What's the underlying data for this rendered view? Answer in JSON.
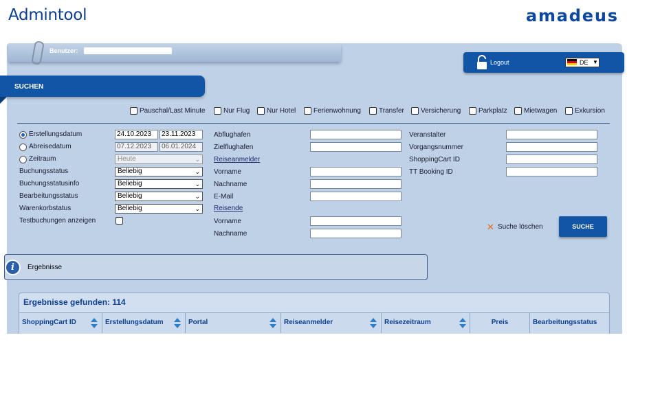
{
  "app": {
    "title": "Admintool",
    "brand": "amadeus",
    "brand_color": "#0d47a1"
  },
  "user": {
    "label": "Benutzer:"
  },
  "session": {
    "logout": "Logout",
    "language": "DE"
  },
  "search_tab": {
    "label": "SUCHEN"
  },
  "products": [
    "Pauschal/Last Minute",
    "Nur Flug",
    "Nur Hotel",
    "Ferienwohnung",
    "Transfer",
    "Versicherung",
    "Parkplatz",
    "Mietwagen",
    "Exkursion"
  ],
  "dates": {
    "erstellungsdatum": {
      "label": "Erstellungsdatum",
      "from": "24.10.2023",
      "to": "23.11.2023",
      "selected": true
    },
    "abreisedatum": {
      "label": "Abreisedatum",
      "from": "07.12.2023",
      "to": "06.01.2024"
    },
    "zeitraum": {
      "label": "Zeitraum",
      "value": "Heute"
    }
  },
  "filters": [
    {
      "label": "Buchungsstatus",
      "value": "Beliebig"
    },
    {
      "label": "Buchungsstatusinfo",
      "value": "Beliebig"
    },
    {
      "label": "Bearbeitungsstatus",
      "value": "Beliebig"
    },
    {
      "label": "Warenkorbstatus",
      "value": "Beliebig"
    }
  ],
  "testbuchungen": {
    "label": "Testbuchungen anzeigen"
  },
  "middle": {
    "abflughafen": "Abflughafen",
    "zielflughafen": "Zielflughafen",
    "reiseanmelder": "Reiseanmelder",
    "vorname": "Vorname",
    "nachname": "Nachname",
    "email": "E-Mail",
    "reisende": "Reisende",
    "vorname2": "Vorname",
    "nachname2": "Nachname"
  },
  "right": {
    "veranstalter": "Veranstalter",
    "vorgangsnummer": "Vorgangsnummer",
    "shoppingcart_id": "ShoppingCart ID",
    "tt_booking_id": "TT Booking ID"
  },
  "actions": {
    "clear": "Suche löschen",
    "search": "SUCHE"
  },
  "results": {
    "section_label": "Ergebnisse",
    "count_text": "Ergebnisse gefunden: 114",
    "columns": [
      "ShoppingCart ID",
      "Erstellungsdatum",
      "Portal",
      "Reiseanmelder",
      "Reisezeitraum",
      "Preis",
      "Bearbeitungsstatus"
    ]
  },
  "colors": {
    "primary": "#1155a7",
    "panel": "#bfd1e6",
    "accent_clear": "#e36a1b"
  }
}
